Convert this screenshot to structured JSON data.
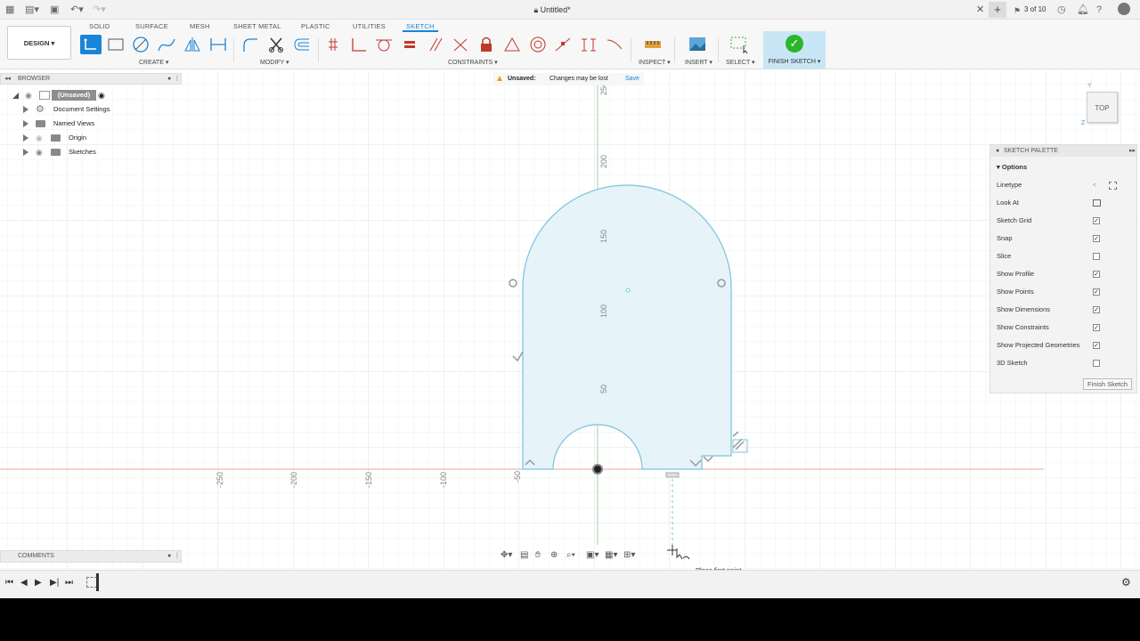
{
  "titlebar": {
    "document_title": "Untitled*",
    "job_count": "3 of 10",
    "icons": [
      "apps-grid-icon",
      "file-icon",
      "save-icon",
      "undo-icon",
      "redo-icon",
      "lock-icon",
      "close-icon",
      "new-tab-icon",
      "jobs-icon",
      "clock-icon",
      "bell-icon",
      "help-icon",
      "avatar-icon"
    ]
  },
  "ribbon": {
    "workspace": "DESIGN",
    "tabs": [
      "SOLID",
      "SURFACE",
      "MESH",
      "SHEET METAL",
      "PLASTIC",
      "UTILITIES",
      "SKETCH"
    ],
    "active_tab": "SKETCH",
    "groups": {
      "create": "CREATE",
      "modify": "MODIFY",
      "constraints": "CONSTRAINTS",
      "inspect": "INSPECT",
      "insert": "INSERT",
      "select": "SELECT",
      "finish": "FINISH SKETCH"
    }
  },
  "browser": {
    "title": "BROWSER",
    "root": "(Unsaved)",
    "items": [
      "Document Settings",
      "Named Views",
      "Origin",
      "Sketches"
    ]
  },
  "notice": {
    "label": "Unsaved:",
    "message": "Changes may be lost",
    "action": "Save"
  },
  "viewcube": {
    "face": "TOP"
  },
  "palette": {
    "title": "SKETCH PALETTE",
    "section": "Options",
    "linetype_label": "Linetype",
    "lookat_label": "Look At",
    "options": [
      {
        "label": "Sketch Grid",
        "checked": true
      },
      {
        "label": "Snap",
        "checked": true
      },
      {
        "label": "Slice",
        "checked": false
      },
      {
        "label": "Show Profile",
        "checked": true
      },
      {
        "label": "Show Points",
        "checked": true
      },
      {
        "label": "Show Dimensions",
        "checked": true
      },
      {
        "label": "Show Constraints",
        "checked": true
      },
      {
        "label": "Show Projected Geometries",
        "checked": true
      },
      {
        "label": "3D Sketch",
        "checked": false
      }
    ],
    "finish_label": "Finish Sketch"
  },
  "canvas": {
    "x_ticks": [
      "-250",
      "-200",
      "-150",
      "-100",
      "-50"
    ],
    "y_ticks": [
      "50",
      "100",
      "150",
      "200",
      "250"
    ],
    "hint": "Place first point"
  },
  "comments": {
    "title": "COMMENTS"
  },
  "colors": {
    "accent": "#1a85d6",
    "sketch_fill": "#e6f3f8",
    "sketch_line": "#7cc3dc",
    "finish_green": "#2db52d"
  }
}
